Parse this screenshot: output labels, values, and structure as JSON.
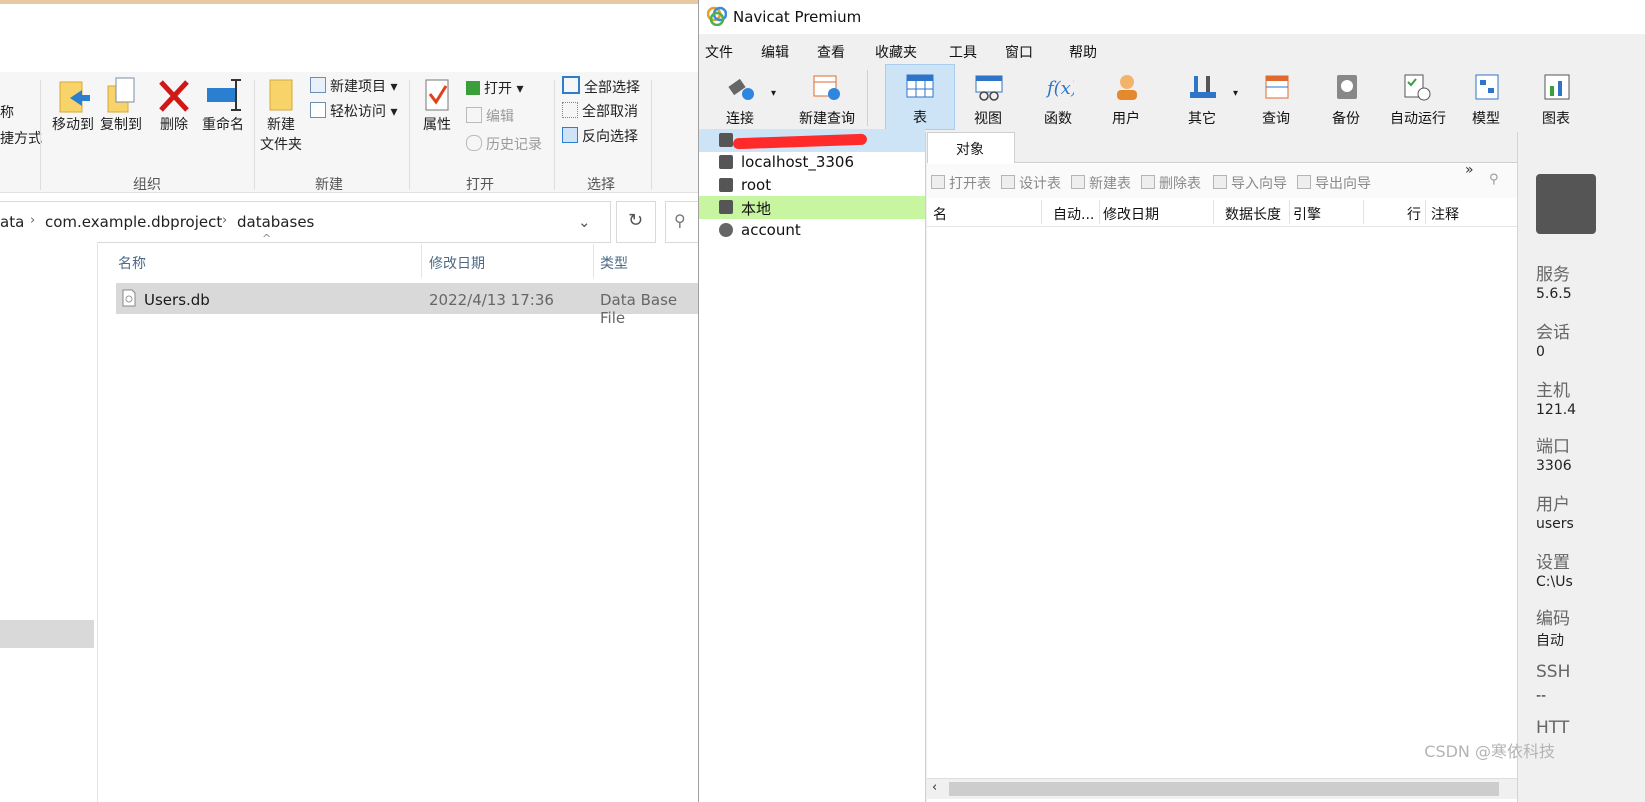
{
  "explorer": {
    "ribbon": {
      "partial_labels": [
        "称",
        "捷方式"
      ],
      "organize": {
        "move_to": "移动到",
        "copy_to": "复制到",
        "delete": "删除",
        "rename": "重命名",
        "group": "组织"
      },
      "new": {
        "new_folder_line1": "新建",
        "new_folder_line2": "文件夹",
        "new_item": "新建项目",
        "easy_access": "轻松访问",
        "group": "新建"
      },
      "open": {
        "properties": "属性",
        "open": "打开",
        "edit": "编辑",
        "history": "历史记录",
        "group": "打开"
      },
      "select": {
        "select_all": "全部选择",
        "select_none": "全部取消",
        "invert": "反向选择",
        "group": "选择"
      }
    },
    "address": {
      "crumbs": [
        "ata",
        "com.example.dbproject",
        "databases"
      ]
    },
    "columns": {
      "name": "名称",
      "modified": "修改日期",
      "type": "类型"
    },
    "files": [
      {
        "name": "Users.db",
        "modified": "2022/4/13 17:36",
        "type": "Data Base File"
      }
    ]
  },
  "navicat": {
    "title": "Navicat Premium",
    "menu": [
      "文件",
      "编辑",
      "查看",
      "收藏夹",
      "工具",
      "窗口",
      "帮助"
    ],
    "toolbar": [
      "连接",
      "新建查询",
      "表",
      "视图",
      "函数",
      "用户",
      "其它",
      "查询",
      "备份",
      "自动运行",
      "模型",
      "图表"
    ],
    "connections": [
      "localhost_3306",
      "root",
      "本地",
      "account"
    ],
    "objects_tab": "对象",
    "object_tools": [
      "打开表",
      "设计表",
      "新建表",
      "删除表",
      "导入向导",
      "导出向导"
    ],
    "object_columns": [
      "名",
      "自动...",
      "修改日期",
      "数据长度",
      "引擎",
      "行",
      "注释"
    ],
    "info": [
      {
        "key": "服务",
        "value": "5.6.5"
      },
      {
        "key": "会话",
        "value": "0"
      },
      {
        "key": "主机",
        "value": "121.4"
      },
      {
        "key": "端口",
        "value": "3306"
      },
      {
        "key": "用户",
        "value": "users"
      },
      {
        "key": "设置",
        "value": "C:\\Us"
      },
      {
        "key": "编码",
        "value": "自动"
      },
      {
        "key": "SSH",
        "value": "--"
      },
      {
        "key": "HTT",
        "value": ""
      }
    ]
  },
  "watermark": "CSDN @寒依科技",
  "colors": {
    "accent_selected": "#cde4f7",
    "tree_highlight": "#c8f5a0",
    "redact": "#ff2a2a"
  }
}
